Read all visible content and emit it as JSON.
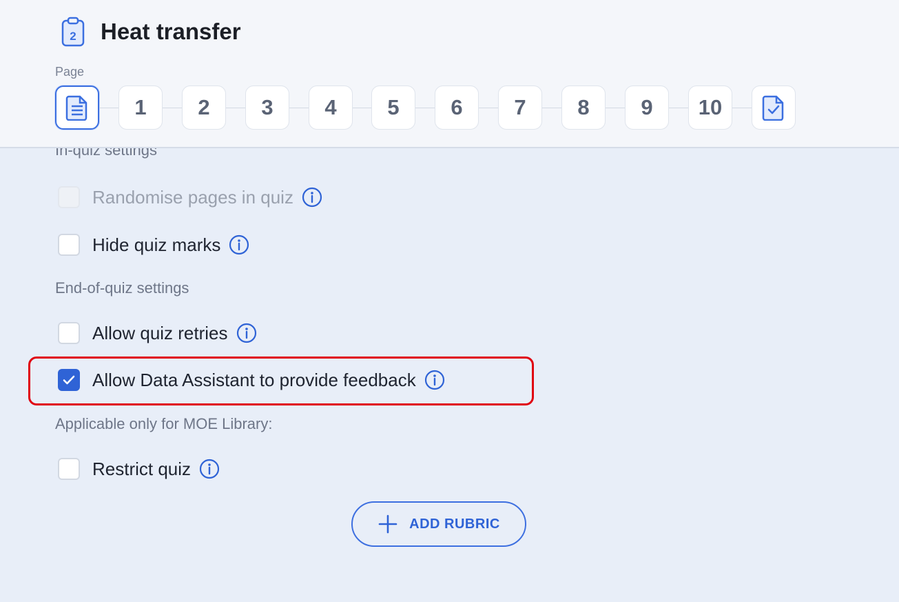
{
  "header": {
    "title": "Heat transfer",
    "title_icon": "clipboard-number-icon",
    "title_icon_number": "2",
    "page_label": "Page"
  },
  "pager": {
    "first_icon": "document-icon",
    "last_icon": "clipboard-check-icon",
    "pages": [
      "1",
      "2",
      "3",
      "4",
      "5",
      "6",
      "7",
      "8",
      "9",
      "10"
    ],
    "active": "document-icon"
  },
  "in_quiz": {
    "label": "In-quiz settings",
    "options": [
      {
        "label": "Randomise pages in quiz",
        "checked": false,
        "disabled": true
      },
      {
        "label": "Hide quiz marks",
        "checked": false,
        "disabled": false
      }
    ]
  },
  "end_of_quiz": {
    "label": "End-of-quiz settings",
    "options": [
      {
        "label": "Allow quiz retries",
        "checked": false,
        "disabled": false
      },
      {
        "label": "Allow Data Assistant to provide feedback",
        "checked": true,
        "disabled": false,
        "highlighted": true
      }
    ]
  },
  "moe": {
    "label": "Applicable only for MOE Library:",
    "options": [
      {
        "label": "Restrict quiz",
        "checked": false,
        "disabled": false
      }
    ]
  },
  "add_rubric": {
    "label": "ADD RUBRIC",
    "icon": "plus-icon"
  },
  "colors": {
    "accent": "#2f63d6",
    "highlight": "#e0000f",
    "background": "#e8eef8"
  }
}
